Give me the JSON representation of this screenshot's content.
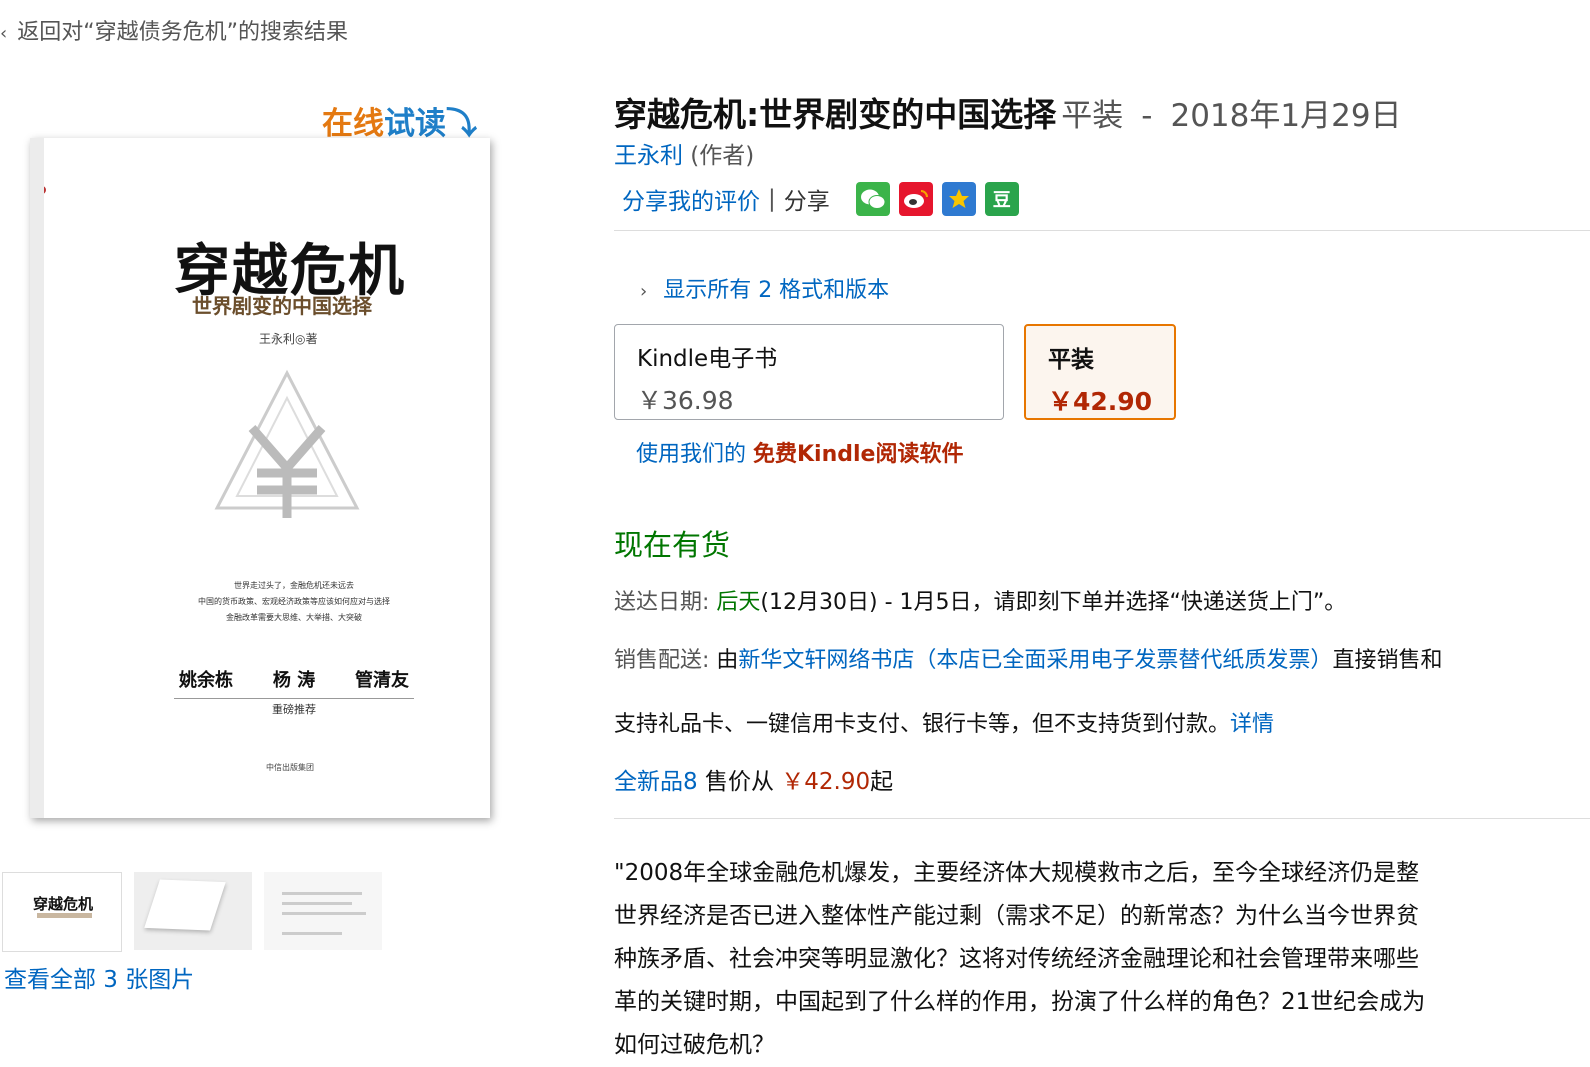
{
  "breadcrumb": {
    "back_label": "返回对“穿越债务危机”的搜索结果"
  },
  "gallery": {
    "try_read_part1": "在线",
    "try_read_part2": "试读",
    "try_read_arrow": "⤵",
    "view_all": "查看全部 3 张图片"
  },
  "cover": {
    "title": "穿越危机",
    "subtitle": "世界剧变的中国选择",
    "author": "王永利◎著",
    "spine_title": "穿越危机",
    "desc_lines": [
      "世界走过头了，金融危机还未远去",
      "中国的货币政策、宏观经济政策等应该如何应对与选择",
      "金融改革需要大思维、大举措、大突破"
    ],
    "endorsers": [
      "姚余栋",
      "杨 涛",
      "管清友"
    ],
    "recommend": "重磅推荐",
    "publisher": "中信出版集团",
    "thumb1_title": "穿越危机"
  },
  "product": {
    "title": "穿越危机:世界剧变的中国选择",
    "binding": "平装",
    "dash": "-",
    "date": "2018年1月29日",
    "author_name": "王永利",
    "author_role": " (作者)"
  },
  "share": {
    "review_link": "分享我的评价",
    "separator": "|",
    "share_label": "分享",
    "icons": [
      "wechat-icon",
      "weibo-icon",
      "qzone-icon",
      "douban-icon"
    ],
    "douban_glyph": "豆"
  },
  "formats": {
    "show_all": "显示所有 2 格式和版本",
    "kindle": {
      "name": "Kindle电子书",
      "price": "￥36.98"
    },
    "paperback": {
      "name": "平装",
      "price": "￥42.90"
    },
    "kindle_app_prefix": "使用我们的 ",
    "kindle_app_link": "免费Kindle阅读软件"
  },
  "availability": {
    "in_stock": "现在有货",
    "delivery_label": "送达日期: ",
    "delivery_day": "后天",
    "delivery_rest": "(12月30日) - 1月5日，请即刻下单并选择“快递送货上门”。",
    "seller_label": "销售配送: ",
    "seller_prefix": "由",
    "seller_name": "新华文轩网络书店（本店已全面采用电子发票替代纸质发票）",
    "seller_suffix": "直接销售和",
    "payment_text": "支持礼品卡、一键信用卡支付、银行卡等，但不支持货到付款。",
    "payment_link": "详情",
    "offers_link": "全新品8",
    "offers_text1": " 售价从 ",
    "offers_price": "￥42.90",
    "offers_text2": "起"
  },
  "description": {
    "lines": [
      "\"2008年全球金融危机爆发，主要经济体大规模救市之后，至今全球经济仍是整",
      "世界经济是否已进入整体性产能过剩（需求不足）的新常态？为什么当今世界贫",
      "种族矛盾、社会冲突等明显激化？这将对传统经济金融理论和社会管理带来哪些",
      "革的关键时期，中国起到了什么样的作用，扮演了什么样的角色？21世纪会成为",
      "如何过破危机？"
    ]
  },
  "colors": {
    "link": "#0066c0",
    "price": "#b12704",
    "in_stock": "#007600",
    "selected_border": "#e77600"
  }
}
